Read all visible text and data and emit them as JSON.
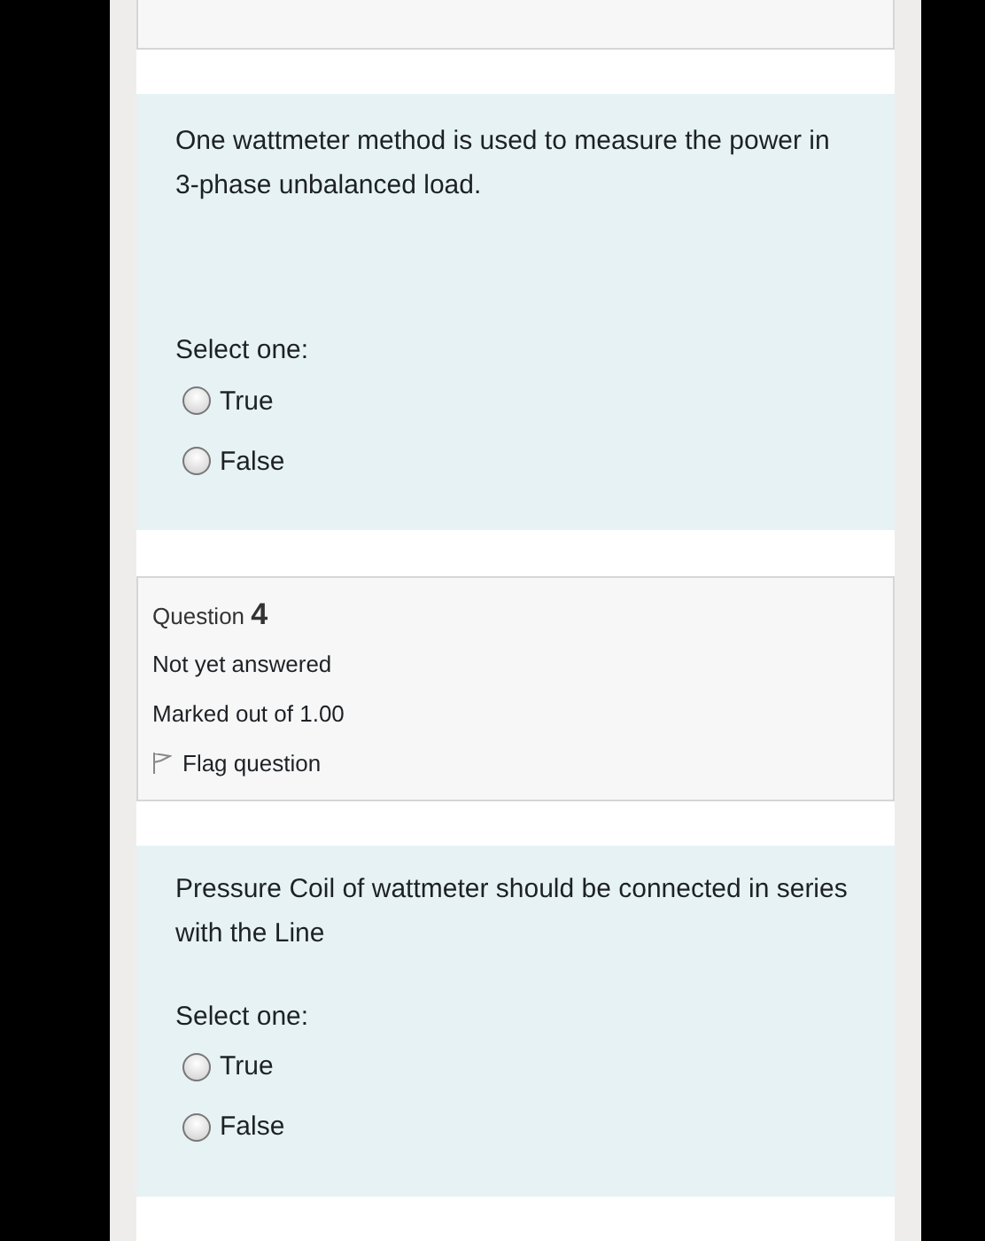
{
  "questions": [
    {
      "text": "One wattmeter method is used to measure the power in 3-phase unbalanced load.",
      "prompt": "Select one:",
      "options": [
        {
          "label": "True",
          "selected": false
        },
        {
          "label": "False",
          "selected": false
        }
      ]
    },
    {
      "info": {
        "label": "Question",
        "number": "4",
        "status": "Not yet answered",
        "marks": "Marked out of 1.00",
        "flag": "Flag question",
        "flagged": false
      },
      "text": "Pressure Coil of wattmeter should be connected in series with the Line",
      "prompt": "Select one:",
      "options": [
        {
          "label": "True",
          "selected": false
        },
        {
          "label": "False",
          "selected": false
        }
      ]
    }
  ]
}
